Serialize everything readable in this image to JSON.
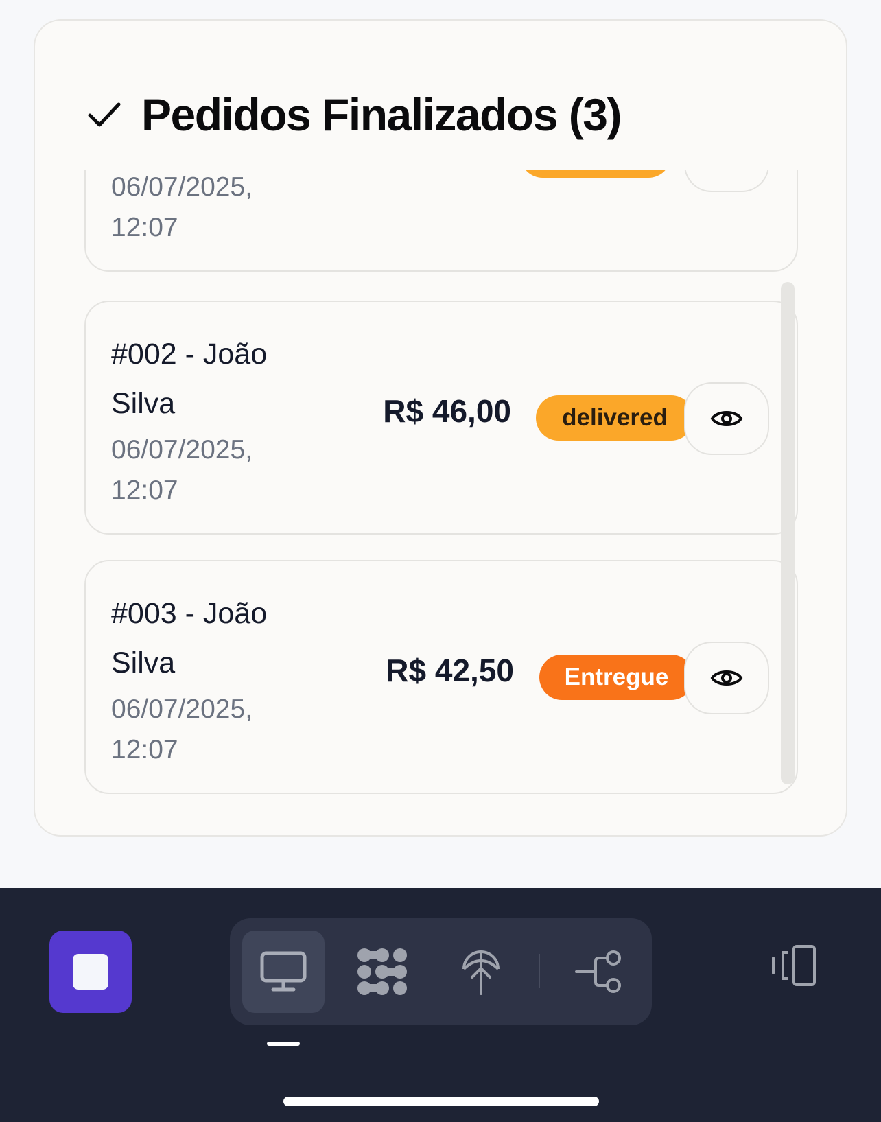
{
  "section": {
    "title": "Pedidos Finalizados (3)",
    "icon": "check-icon"
  },
  "orders": [
    {
      "name": "",
      "date": "06/07/2025, 12:07",
      "price": "",
      "status": "",
      "status_color": "#fba729"
    },
    {
      "name": "#002 - João Silva",
      "date": "06/07/2025, 12:07",
      "price": "R$ 46,00",
      "status": "delivered",
      "status_color": "#fba729"
    },
    {
      "name": "#003 - João Silva",
      "date": "06/07/2025, 12:07",
      "price": "R$ 42,50",
      "status": "Entregue",
      "status_color": "#f97319"
    }
  ],
  "dock": {
    "stop_icon": "stop-icon",
    "tools": [
      "monitor-icon",
      "apps-grid-icon",
      "antenna-icon",
      "branch-icon"
    ],
    "device_icon": "device-rotate-icon",
    "accent_color": "#5539cf"
  }
}
